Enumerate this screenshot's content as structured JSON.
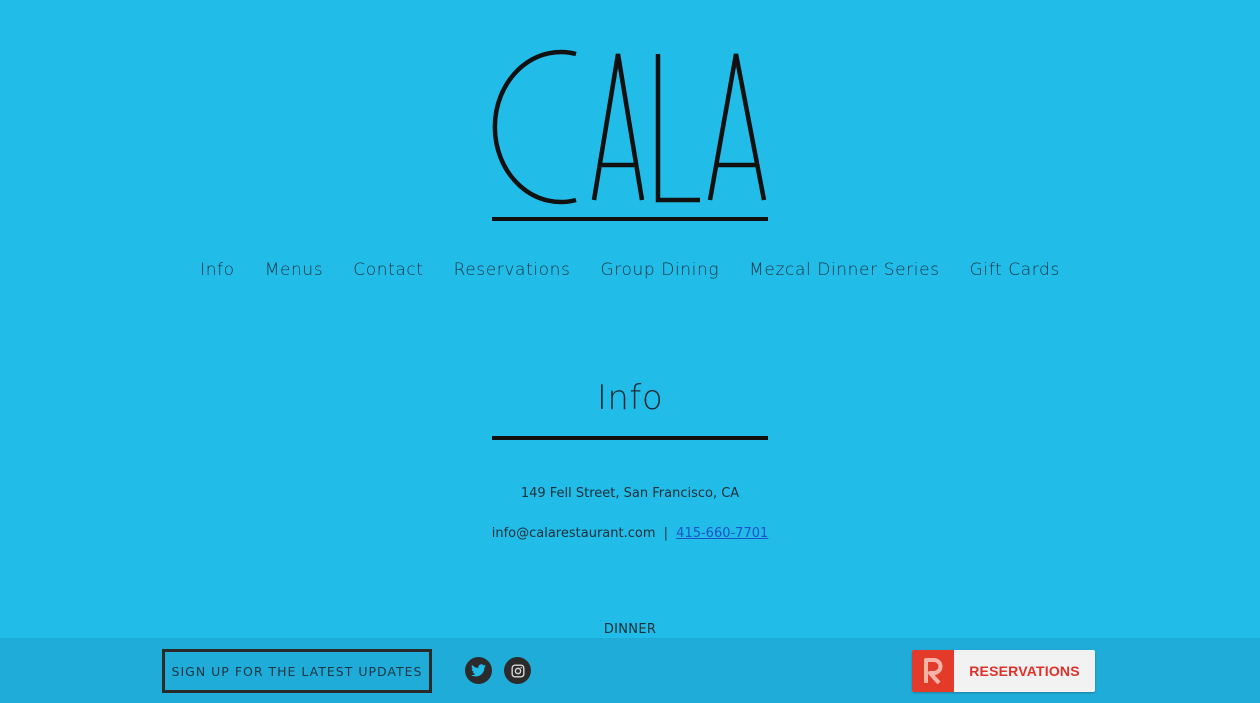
{
  "brand": {
    "name": "CALA"
  },
  "nav": {
    "items": [
      {
        "label": "Info"
      },
      {
        "label": "Menus"
      },
      {
        "label": "Contact"
      },
      {
        "label": "Reservations"
      },
      {
        "label": "Group Dining"
      },
      {
        "label": "Mezcal Dinner Series"
      },
      {
        "label": "Gift Cards"
      }
    ]
  },
  "main": {
    "title": "Info",
    "address": "149 Fell Street, San Francisco, CA",
    "email": "info@calarestaurant.com",
    "separator": "|",
    "phone": "415-660-7701",
    "section_heading": "DINNER"
  },
  "footer": {
    "signup_label": "SIGN UP FOR THE LATEST UPDATES",
    "social": [
      {
        "icon": "twitter-icon"
      },
      {
        "icon": "instagram-icon"
      }
    ],
    "reservations_label": "RESERVATIONS",
    "reservations_badge": "R"
  },
  "colors": {
    "background": "#22bce9",
    "footer_bar": "#20acd8",
    "accent_red": "#e33a2a",
    "link_blue": "#1a56c7"
  }
}
